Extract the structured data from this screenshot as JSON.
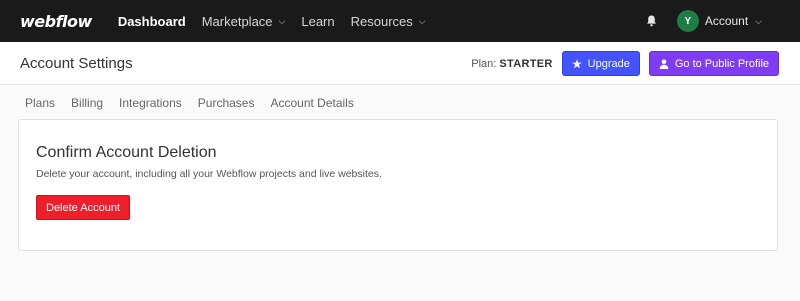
{
  "topbar": {
    "logo": "webflow",
    "nav": [
      {
        "label": "Dashboard",
        "active": true
      },
      {
        "label": "Marketplace",
        "dropdown": true
      },
      {
        "label": "Learn"
      },
      {
        "label": "Resources",
        "dropdown": true
      }
    ],
    "avatar_initial": "Y",
    "account_label": "Account"
  },
  "header": {
    "title": "Account Settings",
    "plan_label": "Plan:",
    "plan_name": "STARTER",
    "upgrade_label": "Upgrade",
    "profile_label": "Go to Public Profile"
  },
  "tabs": [
    "Plans",
    "Billing",
    "Integrations",
    "Purchases",
    "Account Details"
  ],
  "card": {
    "title": "Confirm Account Deletion",
    "description": "Delete your account, including all your Webflow projects and live websites.",
    "delete_label": "Delete Account"
  },
  "colors": {
    "topbar_bg": "#1a1a1a",
    "upgrade_btn": "#4353ff",
    "profile_btn": "#7f3cf2",
    "delete_btn": "#ee1f2a",
    "avatar_bg": "#1e7c45"
  }
}
